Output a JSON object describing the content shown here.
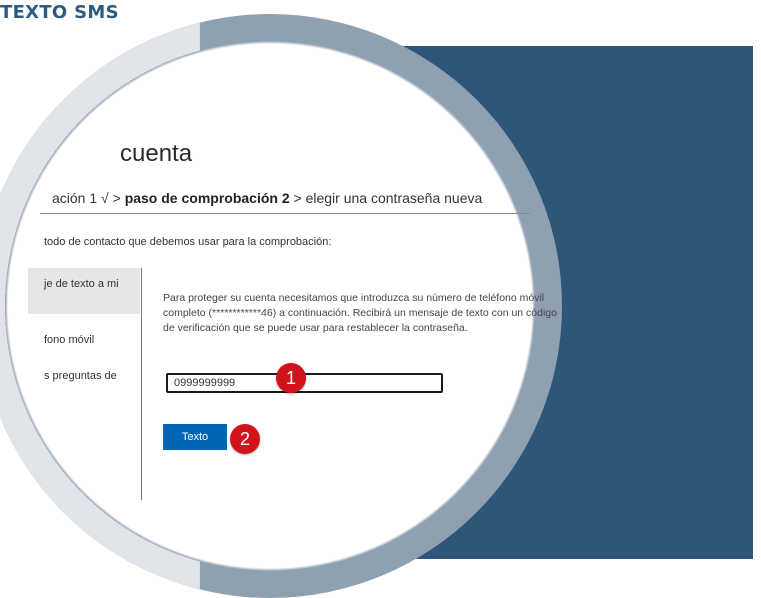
{
  "header": {
    "title": "TEXTO SMS"
  },
  "page": {
    "title": "cuenta",
    "steps": {
      "previous": "ación 1 √ >",
      "current": "paso de comprobación 2",
      "next": "> elegir una contraseña nueva"
    },
    "instruction": "todo de contacto que debemos usar para la comprobación:"
  },
  "sidebar": {
    "items": [
      {
        "label": "je de texto a mi",
        "selected": true
      },
      {
        "label": "fono móvil",
        "selected": false
      },
      {
        "label": "s preguntas de",
        "selected": false
      }
    ]
  },
  "form": {
    "description": "Para proteger su cuenta necesitamos que introduzca su número de teléfono móvil completo (************46) a continuación. Recibirá un mensaje de texto con un código de verificación que se puede usar para restablecer la contraseña.",
    "phone_value": "0999999999",
    "submit_label": "Texto"
  },
  "callouts": {
    "one": "1",
    "two": "2"
  },
  "colors": {
    "header": "#2f5a80",
    "panel": "#2d5679",
    "ring": "#8fa0b1",
    "button": "#0067b8",
    "callout": "#d3131b"
  }
}
